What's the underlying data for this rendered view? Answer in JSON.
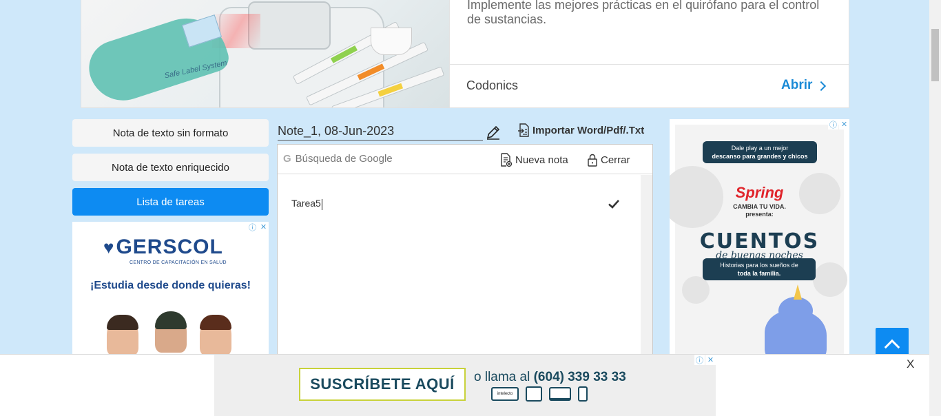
{
  "top_ad": {
    "description": "Implemente las mejores prácticas en el quirófano para el control de sustancias.",
    "brand": "Codonics",
    "cta": "Abrir",
    "image_caption": "Safe Label System"
  },
  "menu": {
    "items": [
      {
        "label": "Nota de texto sin formato",
        "active": false
      },
      {
        "label": "Nota de texto enriquecido",
        "active": false
      },
      {
        "label": "Lista de tareas",
        "active": true
      }
    ]
  },
  "left_ad": {
    "brand": "GERSCOL",
    "subtitle": "CENTRO DE CAPACITACIÓN EN SALUD",
    "tagline": "¡Estudia desde donde quieras!"
  },
  "note": {
    "title": "Note_1, 08-Jun-2023",
    "import_label": "Importar Word/Pdf/.Txt",
    "search_placeholder": "Búsqueda de Google",
    "new_note_label": "Nueva nota",
    "close_label": "Cerrar",
    "tasks": [
      {
        "text": "Tarea5"
      }
    ]
  },
  "right_ad": {
    "top_line1": "Dale play a un mejor",
    "top_line2": "descanso para grandes y chicos",
    "brand": "Spring",
    "brand_sub1": "CAMBIA TU VIDA.",
    "brand_sub2": "presenta:",
    "title": "CUENTOS",
    "title_sub": "de buenas noches",
    "box_line1": "Historias para los sueños de",
    "box_line2": "toda la familia."
  },
  "bottom_ad": {
    "subscribe": "SUSCRÍBETE AQUÍ",
    "phone_prefix": "o llama al",
    "phone": "(604) 339 33 33",
    "close": "X"
  },
  "ad_badge": {
    "info": "ⓘ",
    "close": "✕"
  },
  "colors": {
    "accent": "#0d8bf2",
    "page_bg": "#cfe8fa",
    "link": "#1a8ad6"
  }
}
